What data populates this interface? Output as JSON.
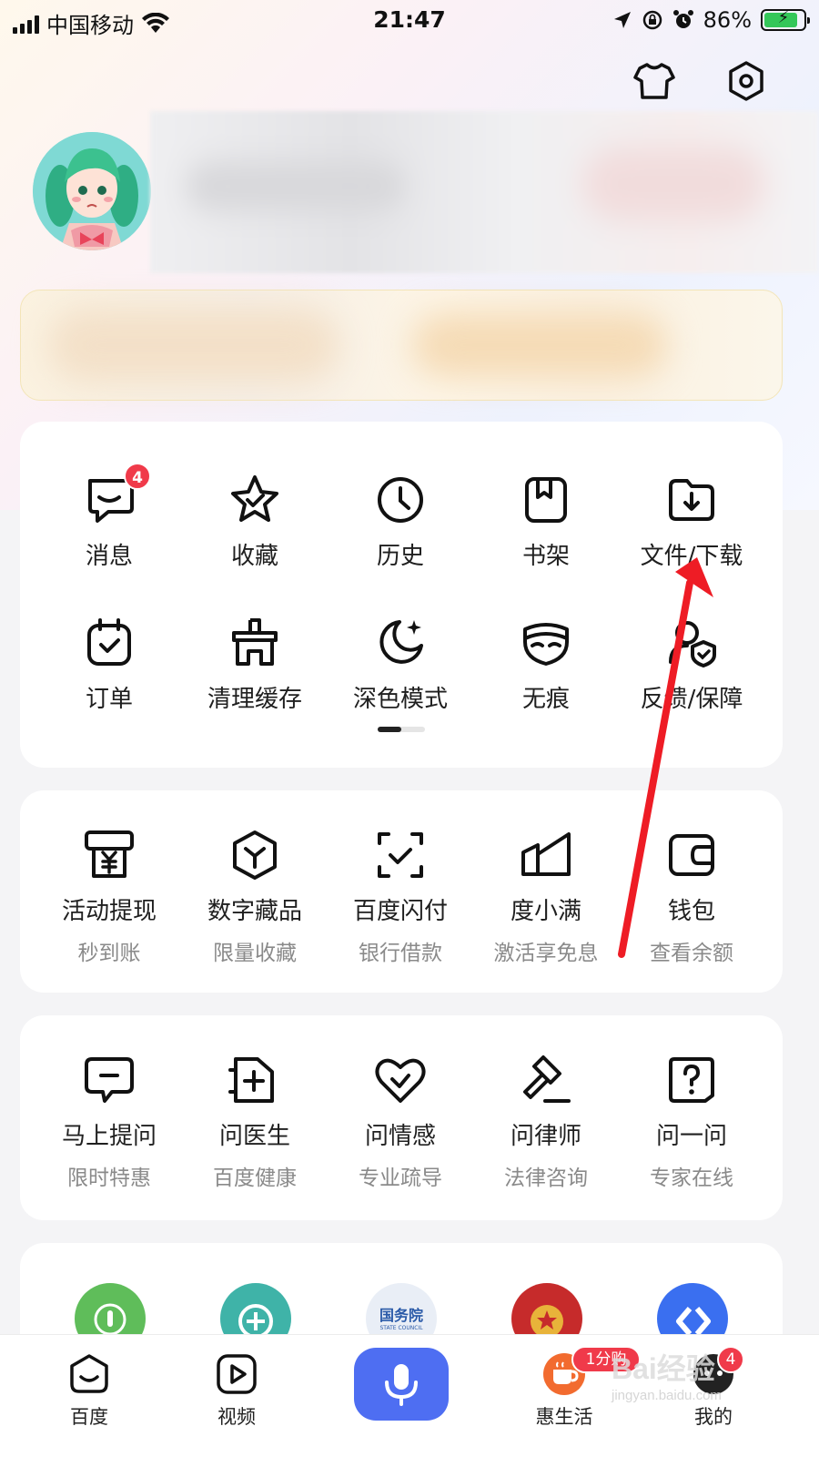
{
  "status_bar": {
    "carrier": "中国移动",
    "time": "21:47",
    "battery": "86%"
  },
  "menu_grid": {
    "row1": [
      {
        "label": "消息",
        "icon": "message-icon",
        "badge": "4"
      },
      {
        "label": "收藏",
        "icon": "star-icon"
      },
      {
        "label": "历史",
        "icon": "clock-icon"
      },
      {
        "label": "书架",
        "icon": "bookshelf-icon"
      },
      {
        "label": "文件/下载",
        "icon": "folder-download-icon"
      }
    ],
    "row2": [
      {
        "label": "订单",
        "icon": "order-calendar-icon"
      },
      {
        "label": "清理缓存",
        "icon": "clean-cache-icon"
      },
      {
        "label": "深色模式",
        "icon": "moon-icon"
      },
      {
        "label": "无痕",
        "icon": "mask-icon"
      },
      {
        "label": "反馈/保障",
        "icon": "feedback-shield-icon"
      }
    ]
  },
  "finance": [
    {
      "label": "活动提现",
      "sub": "秒到账",
      "icon": "cash-withdraw-icon"
    },
    {
      "label": "数字藏品",
      "sub": "限量收藏",
      "icon": "digital-collectible-icon"
    },
    {
      "label": "百度闪付",
      "sub": "银行借款",
      "icon": "flash-pay-icon"
    },
    {
      "label": "度小满",
      "sub": "激活享免息",
      "icon": "duxiaoman-icon"
    },
    {
      "label": "钱包",
      "sub": "查看余额",
      "icon": "wallet-icon"
    }
  ],
  "consult": [
    {
      "label": "马上提问",
      "sub": "限时特惠",
      "icon": "ask-bubble-icon"
    },
    {
      "label": "问医生",
      "sub": "百度健康",
      "icon": "doctor-icon"
    },
    {
      "label": "问情感",
      "sub": "专业疏导",
      "icon": "heart-icon"
    },
    {
      "label": "问律师",
      "sub": "法律咨询",
      "icon": "gavel-icon"
    },
    {
      "label": "问一问",
      "sub": "专家在线",
      "icon": "question-icon"
    }
  ],
  "services_badge_text": "国务院",
  "services_badge_sub": "STATE COUNCIL",
  "tabbar": {
    "items": [
      {
        "label": "百度",
        "icon": "baidu-home-icon"
      },
      {
        "label": "视频",
        "icon": "video-play-icon"
      },
      {
        "label": "",
        "icon": "microphone-icon"
      },
      {
        "label": "惠生活",
        "icon": "coffee-cup-icon",
        "badge": "1分购"
      },
      {
        "label": "我的",
        "icon": "profile-icon",
        "badge": "4"
      }
    ]
  },
  "watermark": {
    "text": "Bai经验",
    "sub": "jingyan.baidu.com"
  },
  "colors": {
    "accent": "#4e6ef2",
    "badge": "#f03a4a",
    "arrow": "#ee1c25"
  }
}
